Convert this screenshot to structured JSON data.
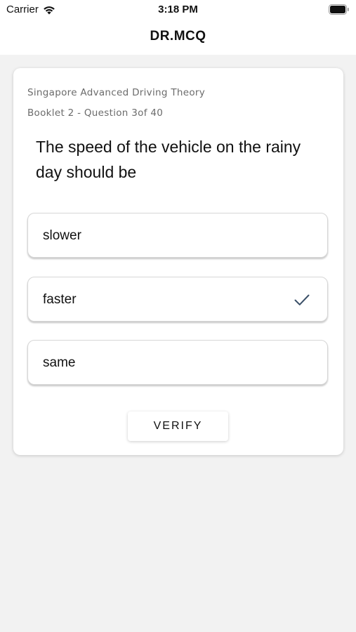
{
  "status_bar": {
    "carrier": "Carrier",
    "time": "3:18 PM"
  },
  "nav": {
    "title": "DR.MCQ"
  },
  "quiz": {
    "booklet": "Singapore Advanced Driving Theory",
    "progress": "Booklet 2 - Question 3of 40",
    "question": "The speed of the vehicle on the rainy day should be",
    "options": [
      {
        "label": "slower",
        "selected": false
      },
      {
        "label": "faster",
        "selected": true
      },
      {
        "label": "same",
        "selected": false
      }
    ],
    "verify_label": "VERIFY"
  },
  "colors": {
    "check": "#3b5068",
    "background": "#f2f2f2"
  },
  "icons": [
    "wifi-icon",
    "battery-icon",
    "checkmark-icon"
  ]
}
